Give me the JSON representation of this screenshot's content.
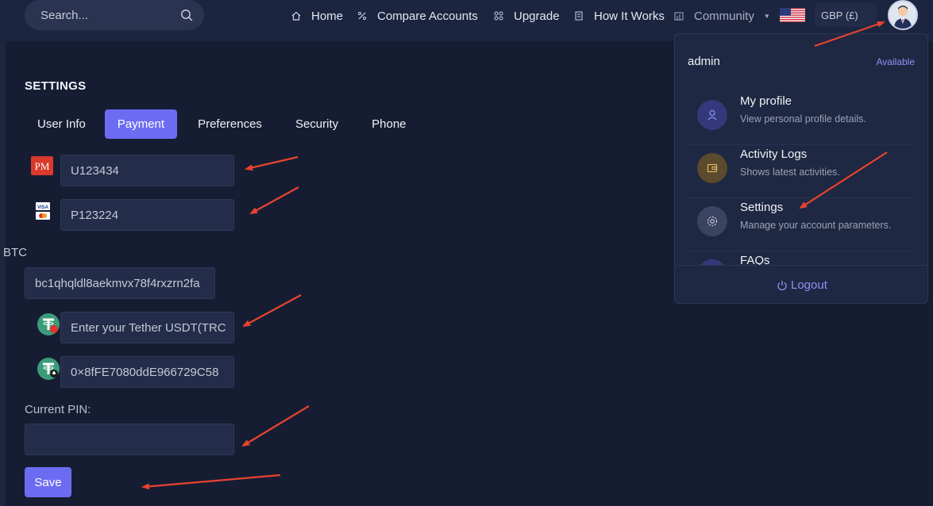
{
  "header": {
    "search_placeholder": "Search...",
    "nav": [
      {
        "label": "Home",
        "icon": "home-icon"
      },
      {
        "label": "Compare Accounts",
        "icon": "percent-icon"
      },
      {
        "label": "Upgrade",
        "icon": "grid-icon"
      },
      {
        "label": "How It Works",
        "icon": "document-icon"
      },
      {
        "label": "Community",
        "icon": "chart-icon"
      }
    ],
    "currency": "GBP (£)",
    "flag": "us-flag-icon"
  },
  "settings": {
    "title": "SETTINGS",
    "tabs": [
      "User Info",
      "Payment",
      "Preferences",
      "Security",
      "Phone"
    ],
    "active_tab": "Payment",
    "fields": {
      "perfect_money": {
        "value": "U123434",
        "icon_text": "PM"
      },
      "payeer": {
        "value": "P123224"
      },
      "btc_label": "BTC",
      "btc": {
        "value": "bc1qhqldl8aekmvx78f4rxzrn2fa"
      },
      "usdt_trc": {
        "placeholder": "Enter your Tether USDT(TRC"
      },
      "usdt_erc": {
        "value": "0×8fFE7080ddE966729C58"
      },
      "pin_label": "Current PIN:",
      "pin": {
        "value": ""
      }
    },
    "save_label": "Save"
  },
  "dropdown": {
    "username": "admin",
    "status": "Available",
    "items": [
      {
        "title": "My profile",
        "desc": "View personal profile details.",
        "icon": "user-icon",
        "color": "#33397a"
      },
      {
        "title": "Activity Logs",
        "desc": "Shows latest activities.",
        "icon": "wallet-icon",
        "color": "#5a4a2e"
      },
      {
        "title": "Settings",
        "desc": "Manage your account parameters.",
        "icon": "gear-icon",
        "color": "#3a4360"
      },
      {
        "title": "FAQs",
        "desc": "",
        "icon": "question-icon",
        "color": "#33397a"
      }
    ],
    "logout_label": "Logout"
  },
  "colors": {
    "accent": "#6c6cf2",
    "background": "#161d33",
    "annotation_arrow": "#e8432f"
  }
}
